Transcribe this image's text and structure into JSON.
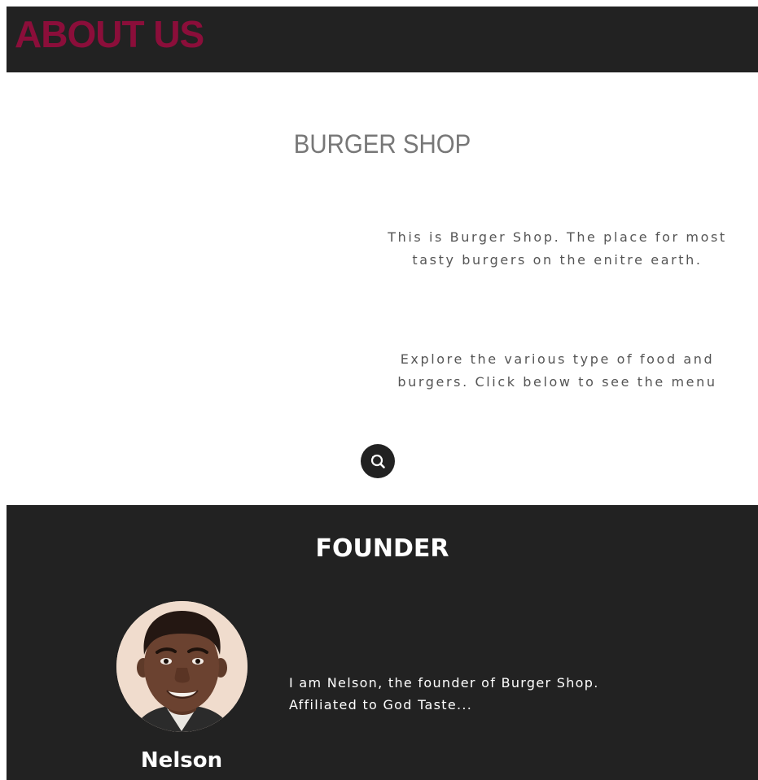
{
  "header": {
    "title": "ABOUT US",
    "title_color": "#8b0e3a",
    "background": "#222222"
  },
  "about": {
    "shop_title": "BURGER SHOP",
    "intro_text": "This is Burger Shop. The place for most tasty burgers on the enitre earth.",
    "explore_text": "Explore the various type of food and burgers. Click below to see the menu",
    "menu_button_icon": "refresh-search-icon"
  },
  "founder": {
    "heading": "FOUNDER",
    "name": "Nelson",
    "bio": "I am Nelson, the founder of Burger Shop. Affiliated to God Taste...",
    "avatar_icon": "founder-photo"
  }
}
